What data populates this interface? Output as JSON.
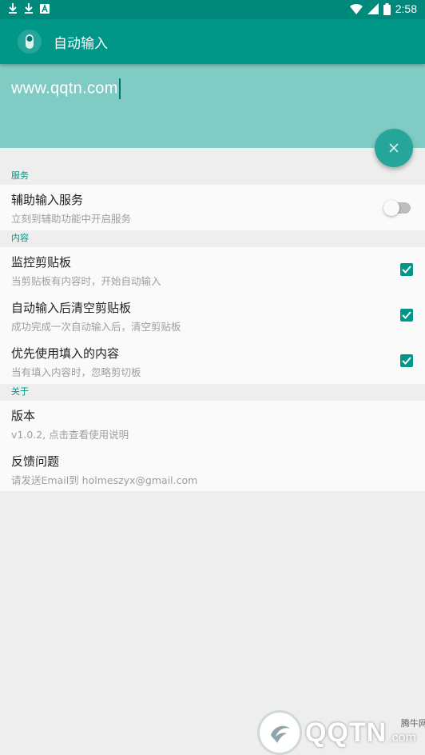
{
  "status_bar": {
    "time": "2:58",
    "left_icons": [
      "download-icon",
      "download-icon",
      "notification-a-icon"
    ],
    "right_icons": [
      "wifi-icon",
      "signal-icon",
      "battery-icon"
    ]
  },
  "app_bar": {
    "title": "自动输入",
    "icon": "app-toggle-icon"
  },
  "input": {
    "value": "www.qqtn.com"
  },
  "fab": {
    "icon": "close-icon"
  },
  "sections": [
    {
      "header": "服务",
      "items": [
        {
          "title": "辅助输入服务",
          "summary": "立刻到辅助功能中开启服务",
          "control": "switch",
          "checked": false
        }
      ]
    },
    {
      "header": "内容",
      "items": [
        {
          "title": "监控剪贴板",
          "summary": "当剪贴板有内容时，开始自动输入",
          "control": "checkbox",
          "checked": true
        },
        {
          "title": "自动输入后清空剪贴板",
          "summary": "成功完成一次自动输入后，清空剪贴板",
          "control": "checkbox",
          "checked": true
        },
        {
          "title": "优先使用填入的内容",
          "summary": "当有填入内容时，忽略剪切板",
          "control": "checkbox",
          "checked": true
        }
      ]
    },
    {
      "header": "关于",
      "items": [
        {
          "title": "版本",
          "summary": "v1.0.2, 点击查看使用说明"
        },
        {
          "title": "反馈问题",
          "summary": "请发送Email到 holmeszyx@gmail.com"
        }
      ]
    }
  ],
  "watermark": {
    "brand": "QQTN",
    "suffix": ".com",
    "cn": "腾牛网"
  },
  "colors": {
    "primary": "#009688",
    "primary_dark": "#00897b",
    "input_bg": "#80cbc4",
    "accent": "#26a69a"
  }
}
